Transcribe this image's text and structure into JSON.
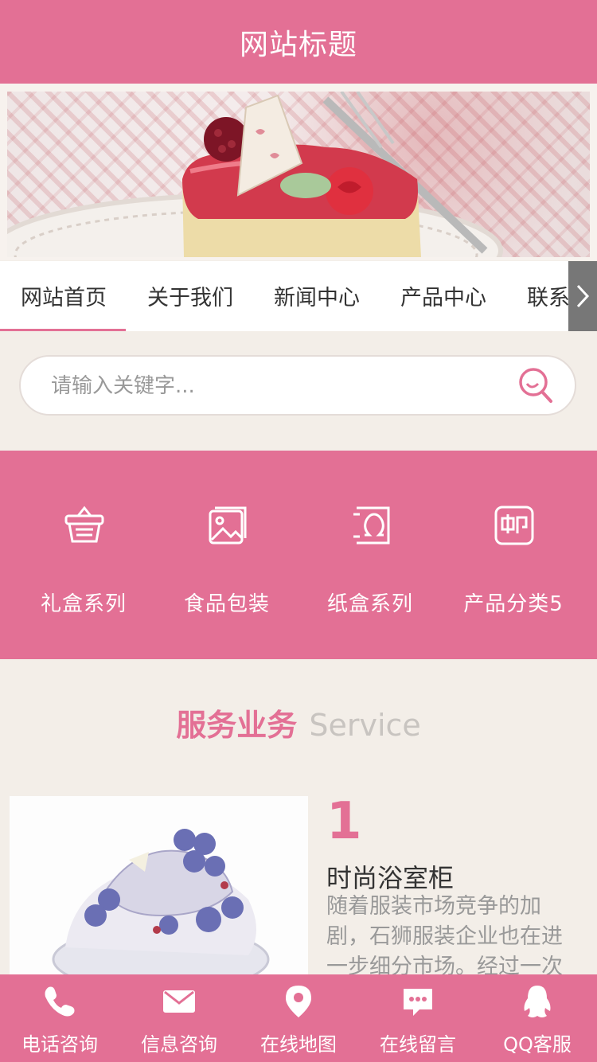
{
  "header": {
    "title": "网站标题"
  },
  "nav": {
    "items": [
      {
        "label": "网站首页"
      },
      {
        "label": "关于我们"
      },
      {
        "label": "新闻中心"
      },
      {
        "label": "产品中心"
      },
      {
        "label": "联系我们"
      }
    ]
  },
  "search": {
    "placeholder": "请输入关键字..."
  },
  "categories": [
    {
      "label": "礼盒系列",
      "icon": "basket-icon"
    },
    {
      "label": "食品包装",
      "icon": "image-icon"
    },
    {
      "label": "纸盒系列",
      "icon": "omega-icon"
    },
    {
      "label": "产品分类5",
      "icon": "mail-icon"
    }
  ],
  "service": {
    "title_cn": "服务业务",
    "title_en": "Service",
    "item": {
      "number": "1",
      "name": "时尚浴室柜",
      "desc": "随着服装市场竞争的加剧，石狮服装企业也在进一步细分市场。经过一次"
    }
  },
  "footer": {
    "items": [
      {
        "label": "电话咨询",
        "icon": "phone-icon"
      },
      {
        "label": "信息咨询",
        "icon": "mail-icon"
      },
      {
        "label": "在线地图",
        "icon": "location-icon"
      },
      {
        "label": "在线留言",
        "icon": "chat-icon"
      },
      {
        "label": "QQ客服",
        "icon": "qq-icon"
      }
    ]
  },
  "colors": {
    "accent": "#e37095",
    "background": "#f3eee8"
  }
}
